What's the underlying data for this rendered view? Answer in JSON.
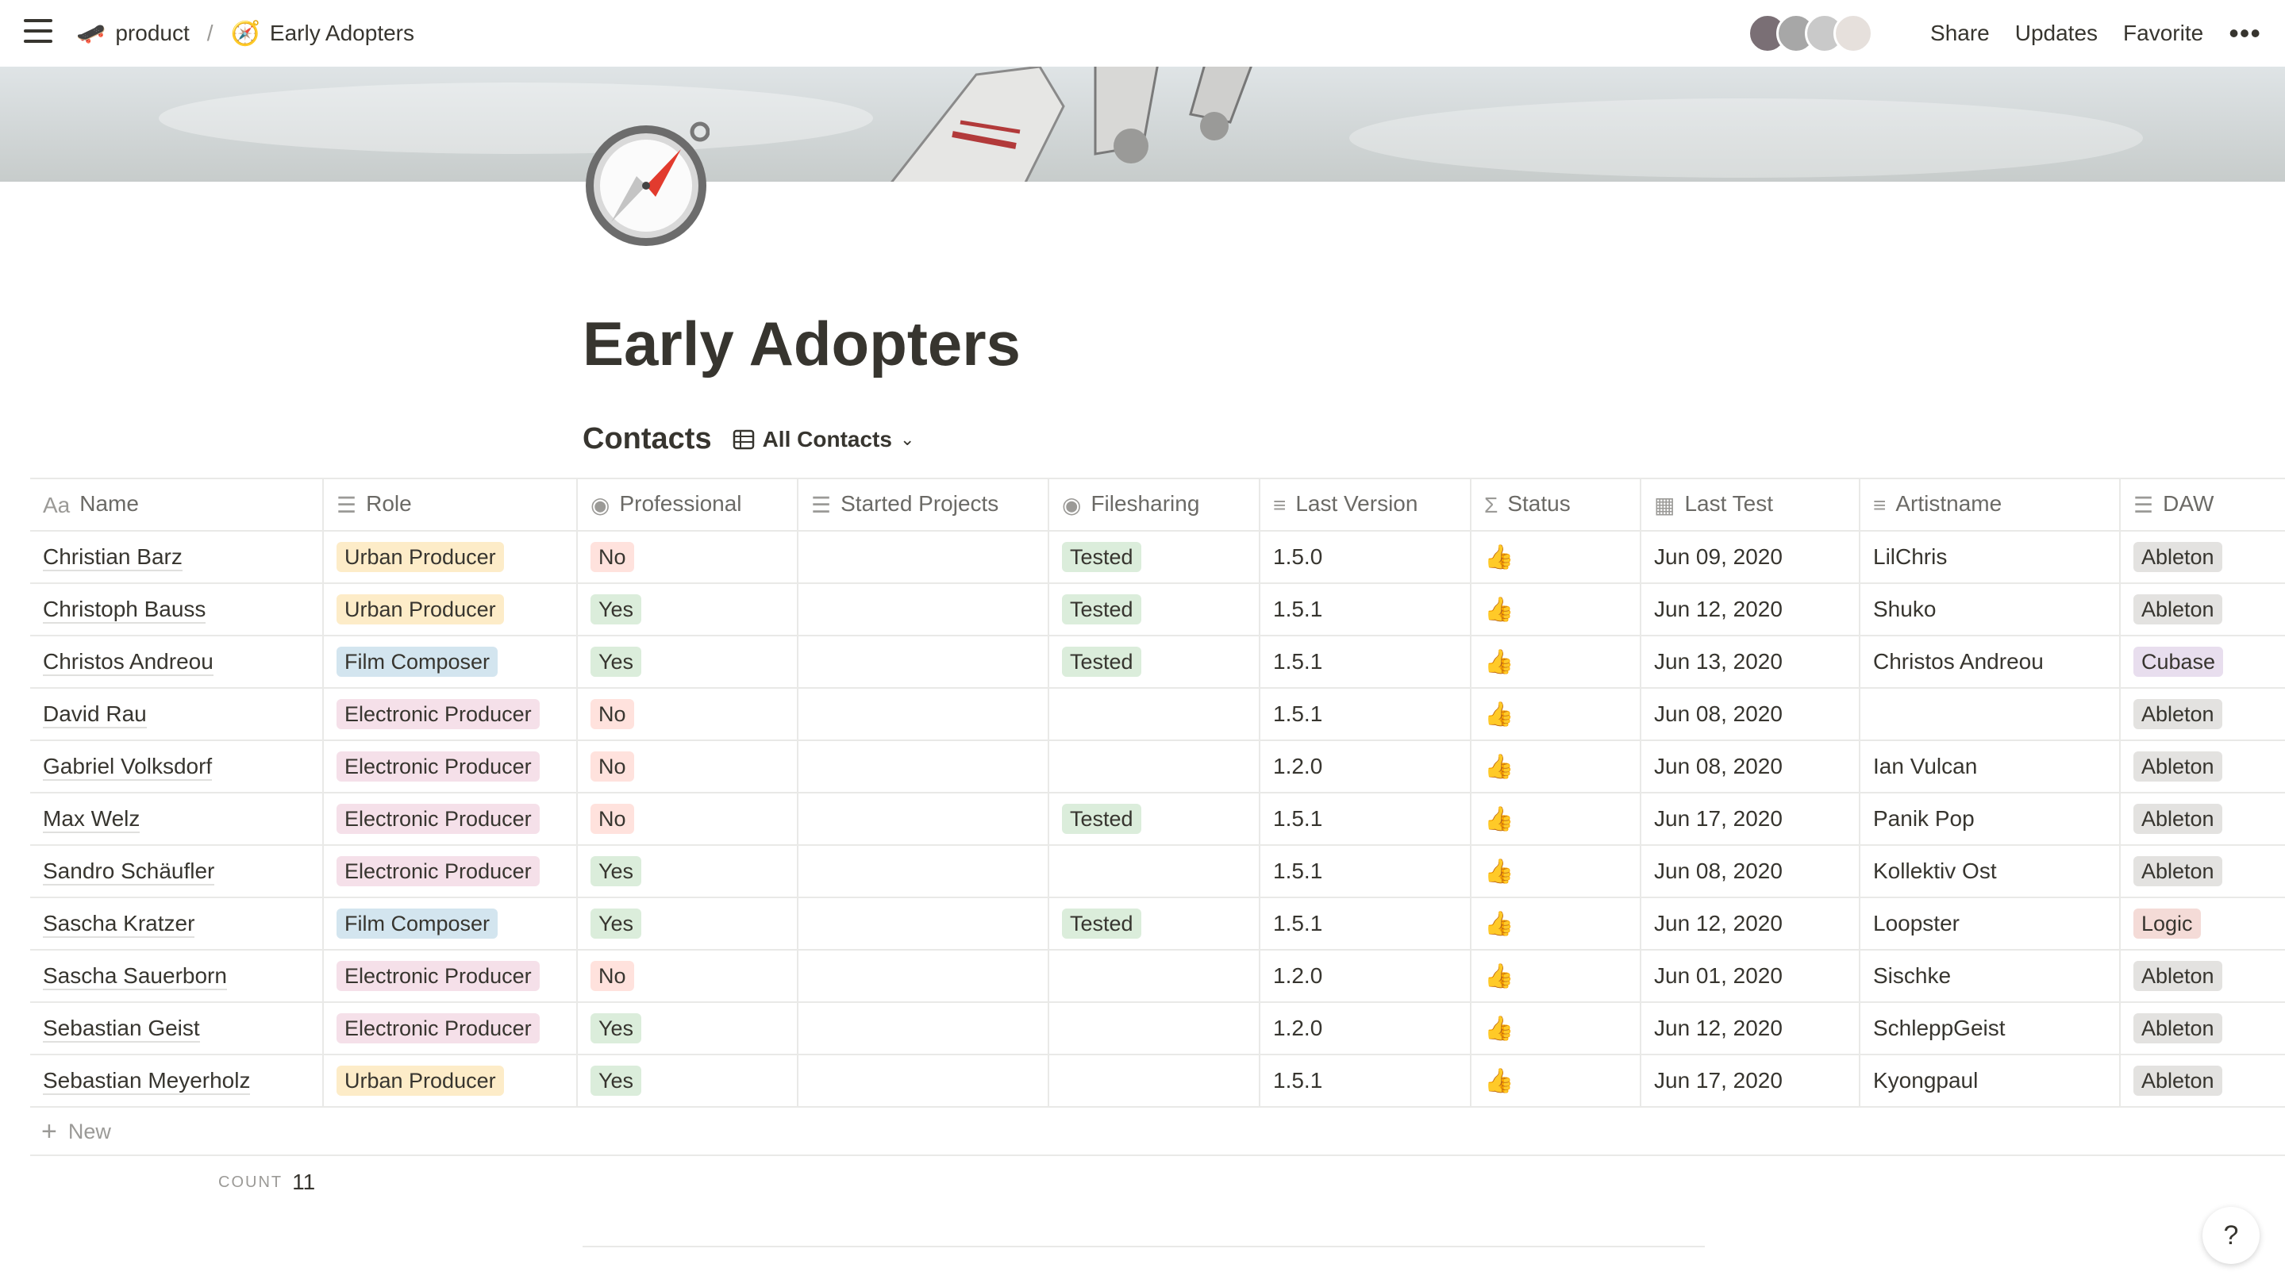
{
  "breadcrumb": {
    "workspace": "product",
    "page": "Early Adopters"
  },
  "topbar": {
    "share": "Share",
    "updates": "Updates",
    "favorite": "Favorite"
  },
  "page": {
    "title": "Early Adopters",
    "icon": "compass-icon"
  },
  "database": {
    "title": "Contacts",
    "view": "All Contacts"
  },
  "columns": [
    "Name",
    "Role",
    "Professional",
    "Started Projects",
    "Filesharing",
    "Last Version",
    "Status",
    "Last Test",
    "Artistname",
    "DAW"
  ],
  "colors": {
    "Urban Producer": "#fdecc8",
    "Film Composer": "#d3e5ef",
    "Electronic Producer": "#f5e0e9",
    "No": "#ffe2dd",
    "Yes": "#dbeddb",
    "Tested": "#dbeddb",
    "Ableton": "#e3e2e0",
    "Cubase": "#e8deee",
    "Logic": "#f4dbd7"
  },
  "rows": [
    {
      "name": "Christian Barz",
      "role": "Urban Producer",
      "professional": "No",
      "started": "",
      "filesharing": "Tested",
      "version": "1.5.0",
      "status": "👍",
      "last_test": "Jun 09, 2020",
      "artist": "LilChris",
      "daw": "Ableton"
    },
    {
      "name": "Christoph Bauss",
      "role": "Urban Producer",
      "professional": "Yes",
      "started": "",
      "filesharing": "Tested",
      "version": "1.5.1",
      "status": "👍",
      "last_test": "Jun 12, 2020",
      "artist": "Shuko",
      "daw": "Ableton"
    },
    {
      "name": "Christos Andreou",
      "role": "Film Composer",
      "professional": "Yes",
      "started": "",
      "filesharing": "Tested",
      "version": "1.5.1",
      "status": "👍",
      "last_test": "Jun 13, 2020",
      "artist": "Christos Andreou",
      "daw": "Cubase"
    },
    {
      "name": "David Rau",
      "role": "Electronic Producer",
      "professional": "No",
      "started": "",
      "filesharing": "",
      "version": "1.5.1",
      "status": "👍",
      "last_test": "Jun 08, 2020",
      "artist": "",
      "daw": "Ableton"
    },
    {
      "name": "Gabriel Volksdorf",
      "role": "Electronic Producer",
      "professional": "No",
      "started": "",
      "filesharing": "",
      "version": "1.2.0",
      "status": "👍",
      "last_test": "Jun 08, 2020",
      "artist": "Ian Vulcan",
      "daw": "Ableton"
    },
    {
      "name": "Max Welz",
      "role": "Electronic Producer",
      "professional": "No",
      "started": "",
      "filesharing": "Tested",
      "version": "1.5.1",
      "status": "👍",
      "last_test": "Jun 17, 2020",
      "artist": "Panik Pop",
      "daw": "Ableton"
    },
    {
      "name": "Sandro Schäufler",
      "role": "Electronic Producer",
      "professional": "Yes",
      "started": "",
      "filesharing": "",
      "version": "1.5.1",
      "status": "👍",
      "last_test": "Jun 08, 2020",
      "artist": "Kollektiv Ost",
      "daw": "Ableton"
    },
    {
      "name": "Sascha Kratzer",
      "role": "Film Composer",
      "professional": "Yes",
      "started": "",
      "filesharing": "Tested",
      "version": "1.5.1",
      "status": "👍",
      "last_test": "Jun 12, 2020",
      "artist": "Loopster",
      "daw": "Logic"
    },
    {
      "name": "Sascha Sauerborn",
      "role": "Electronic Producer",
      "professional": "No",
      "started": "",
      "filesharing": "",
      "version": "1.2.0",
      "status": "👍",
      "last_test": "Jun 01, 2020",
      "artist": "Sischke",
      "daw": "Ableton"
    },
    {
      "name": "Sebastian Geist",
      "role": "Electronic Producer",
      "professional": "Yes",
      "started": "",
      "filesharing": "",
      "version": "1.2.0",
      "status": "👍",
      "last_test": "Jun 12, 2020",
      "artist": "SchleppGeist",
      "daw": "Ableton"
    },
    {
      "name": "Sebastian Meyerholz",
      "role": "Urban Producer",
      "professional": "Yes",
      "started": "",
      "filesharing": "",
      "version": "1.5.1",
      "status": "👍",
      "last_test": "Jun 17, 2020",
      "artist": "Kyongpaul",
      "daw": "Ableton"
    }
  ],
  "footer": {
    "new_label": "New",
    "count_label": "COUNT",
    "count_value": "11",
    "help": "?"
  }
}
